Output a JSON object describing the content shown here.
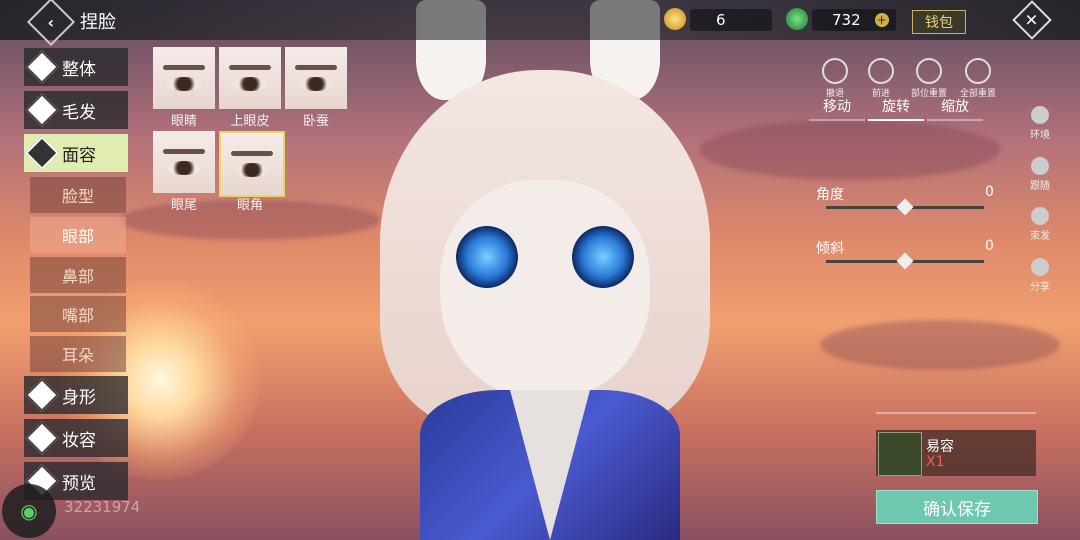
{
  "header": {
    "title": "捏脸",
    "resource1": "6",
    "resource2": "732",
    "wallet_label": "钱包"
  },
  "categories": [
    {
      "label": "整体",
      "active": false
    },
    {
      "label": "毛发",
      "active": false
    },
    {
      "label": "面容",
      "active": true
    },
    {
      "label": "身形",
      "active": false
    },
    {
      "label": "妆容",
      "active": false
    },
    {
      "label": "预览",
      "active": false
    }
  ],
  "subcategories": [
    {
      "label": "脸型",
      "active": false
    },
    {
      "label": "眼部",
      "active": true
    },
    {
      "label": "鼻部",
      "active": false
    },
    {
      "label": "嘴部",
      "active": false
    },
    {
      "label": "耳朵",
      "active": false
    }
  ],
  "thumbnails": [
    {
      "label": "眼睛",
      "selected": false
    },
    {
      "label": "上眼皮",
      "selected": false
    },
    {
      "label": "卧蚕",
      "selected": false
    },
    {
      "label": "眼尾",
      "selected": false
    },
    {
      "label": "眼角",
      "selected": true
    }
  ],
  "tools": [
    "撤退",
    "前进",
    "部位重置",
    "全部重置"
  ],
  "tabs": [
    {
      "label": "移动",
      "active": false
    },
    {
      "label": "旋转",
      "active": true
    },
    {
      "label": "缩放",
      "active": false
    }
  ],
  "sliders": [
    {
      "label": "角度",
      "value": "0",
      "fraction": 0.5
    },
    {
      "label": "倾斜",
      "value": "0",
      "fraction": 0.5
    }
  ],
  "side_buttons": [
    "环境",
    "跟随",
    "束发",
    "分享"
  ],
  "item": {
    "name": "易容",
    "count": "X1"
  },
  "save_label": "确认保存",
  "uid": "32231974"
}
